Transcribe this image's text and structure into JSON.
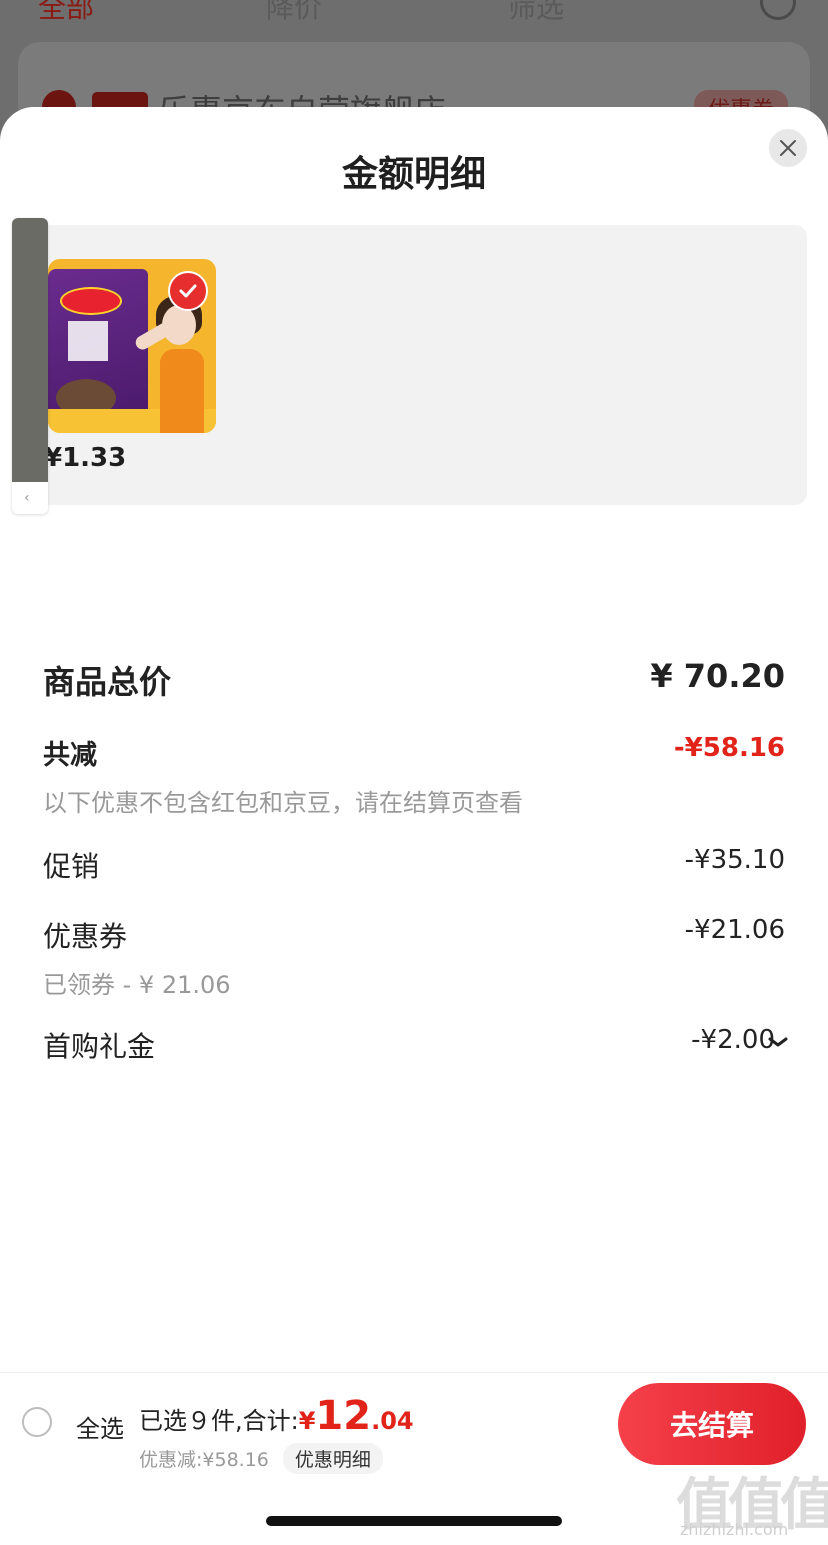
{
  "background": {
    "tabs": [
      "全部",
      "降价",
      "筛选"
    ],
    "store_name": "乐惠京东自营旗舰店",
    "coupon_label": "优惠券"
  },
  "sheet": {
    "title": "金额明细"
  },
  "product": {
    "price": "¥1.33",
    "checked": true
  },
  "summary": {
    "total_label": "商品总价",
    "total_value": "¥ 70.20",
    "reduce_label": "共减",
    "reduce_value": "-¥58.16",
    "note": "以下优惠不包含红包和京豆，请在结算页查看",
    "promo_label": "促销",
    "promo_value": "-¥35.10",
    "coupon_label": "优惠券",
    "coupon_value": "-¥21.06",
    "coupon_sub": "已领券 - ¥ 21.06",
    "gift_label": "首购礼金",
    "gift_value": "-¥2.00"
  },
  "bottom_bar": {
    "select_all": "全选",
    "selected_text": "已选９件,合计:",
    "currency": "¥",
    "total_int": "12",
    "total_dec": ".04",
    "discount_text": "优惠减:¥58.16",
    "detail_label": "优惠明细",
    "checkout_label": "去结算"
  },
  "watermark": {
    "text": "值值值",
    "url": "zhizhizhi.com"
  },
  "colors": {
    "accent": "#e2231a",
    "checkout_start": "#f5404a",
    "checkout_end": "#e0202a"
  }
}
